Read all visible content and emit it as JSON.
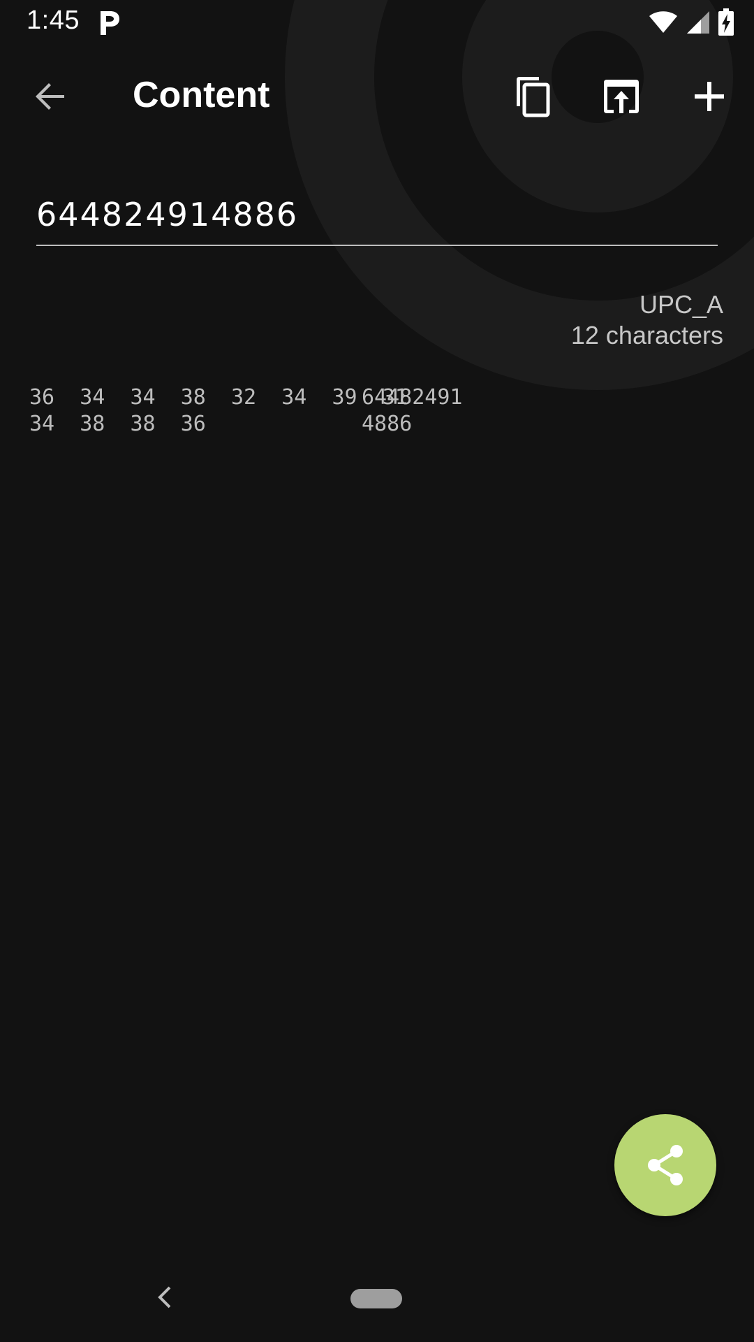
{
  "status_bar": {
    "time": "1:45",
    "app_icon": "parking-p-icon",
    "wifi_icon": "wifi-icon",
    "signal_icon": "cell-signal-icon",
    "battery_icon": "battery-charging-icon"
  },
  "app_bar": {
    "title": "Content",
    "back_icon": "arrow-back-icon",
    "actions": [
      {
        "name": "copy",
        "icon": "copy-icon"
      },
      {
        "name": "open",
        "icon": "open-in-app-icon"
      },
      {
        "name": "add",
        "icon": "add-icon"
      }
    ]
  },
  "content": {
    "value": "644824914886"
  },
  "format_info": {
    "format": "UPC_A",
    "length": "12 characters"
  },
  "hex_dump": [
    {
      "bytes": "36  34  34  38  32  34  39  31",
      "text": "64482491"
    },
    {
      "bytes": "34  38  38  36",
      "text": "4886"
    }
  ],
  "fab": {
    "icon": "share-icon"
  },
  "nav_bar": {
    "back_icon": "nav-back-icon",
    "home_icon": "home-pill-icon"
  },
  "colors": {
    "background": "#121212",
    "ring": "#1c1c1c",
    "fab": "#b8d672",
    "text_secondary": "#c8c8c8"
  }
}
